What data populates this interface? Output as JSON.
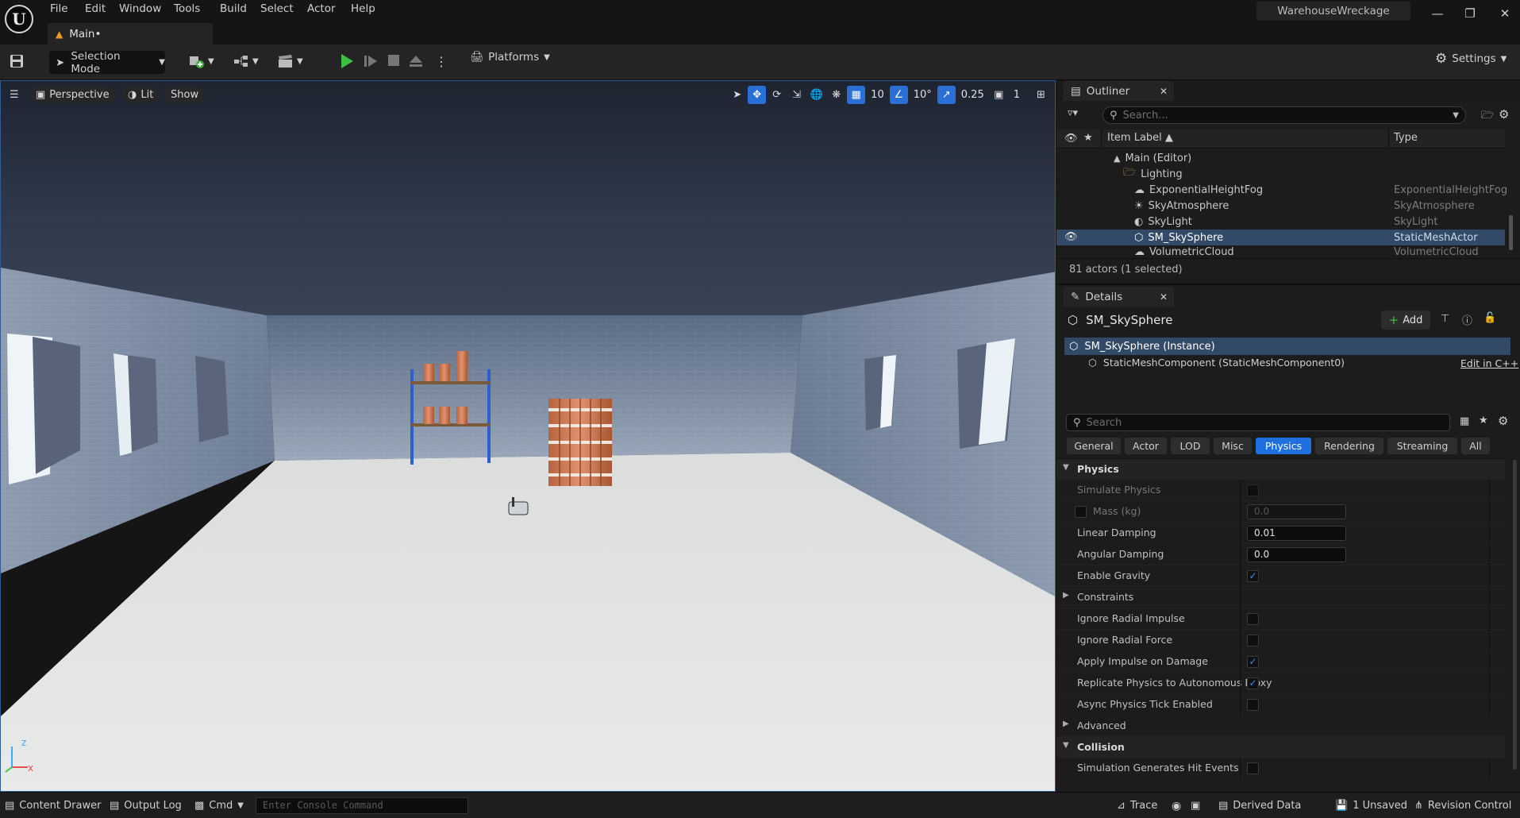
{
  "app": {
    "project_name": "WarehouseWreckage",
    "tab_label": "Main•"
  },
  "menu": [
    "File",
    "Edit",
    "Window",
    "Tools",
    "Build",
    "Select",
    "Actor",
    "Help"
  ],
  "toolbar": {
    "selection_mode": "Selection Mode",
    "platforms": "Platforms",
    "settings": "Settings"
  },
  "viewport": {
    "perspective": "Perspective",
    "lit": "Lit",
    "show": "Show",
    "grid_snap": "10",
    "rotation_snap": "10°",
    "scale_snap": "0.25",
    "camera_speed": "1",
    "axis_z": "z",
    "axis_x": "x"
  },
  "outliner": {
    "title": "Outliner",
    "search_placeholder": "Search...",
    "col_label": "Item Label ▲",
    "col_type": "Type",
    "rows": [
      {
        "label": "Main (Editor)",
        "type": ""
      },
      {
        "label": "Lighting",
        "type": ""
      },
      {
        "label": "ExponentialHeightFog",
        "type": "ExponentialHeightFog"
      },
      {
        "label": "SkyAtmosphere",
        "type": "SkyAtmosphere"
      },
      {
        "label": "SkyLight",
        "type": "SkyLight"
      },
      {
        "label": "SM_SkySphere",
        "type": "StaticMeshActor"
      },
      {
        "label": "VolumetricCloud",
        "type": "VolumetricCloud"
      }
    ],
    "footer": "81 actors (1 selected)"
  },
  "details": {
    "title": "Details",
    "actor_name": "SM_SkySphere",
    "add_label": "Add",
    "instance_label": "SM_SkySphere (Instance)",
    "component_label": "StaticMeshComponent (StaticMeshComponent0)",
    "edit_cpp": "Edit in C++",
    "search_placeholder": "Search",
    "categories": [
      "General",
      "Actor",
      "LOD",
      "Misc",
      "Physics",
      "Rendering",
      "Streaming",
      "All"
    ],
    "active_category": "Physics",
    "section_physics": "Physics",
    "section_collision": "Collision",
    "props": {
      "simulate_physics": "Simulate Physics",
      "mass": "Mass (kg)",
      "mass_value": "0.0",
      "linear_damping": "Linear Damping",
      "linear_damping_value": "0.01",
      "angular_damping": "Angular Damping",
      "angular_damping_value": "0.0",
      "enable_gravity": "Enable Gravity",
      "constraints": "Constraints",
      "ignore_radial_impulse": "Ignore Radial Impulse",
      "ignore_radial_force": "Ignore Radial Force",
      "apply_impulse": "Apply Impulse on Damage",
      "replicate_physics": "Replicate Physics to Autonomous Proxy",
      "async_tick": "Async Physics Tick Enabled",
      "advanced": "Advanced",
      "sim_hit_events": "Simulation Generates Hit Events"
    }
  },
  "statusbar": {
    "content_drawer": "Content Drawer",
    "output_log": "Output Log",
    "cmd": "Cmd",
    "console_placeholder": "Enter Console Command",
    "trace": "Trace",
    "derived_data": "Derived Data",
    "unsaved": "1 Unsaved",
    "revision_control": "Revision Control"
  }
}
